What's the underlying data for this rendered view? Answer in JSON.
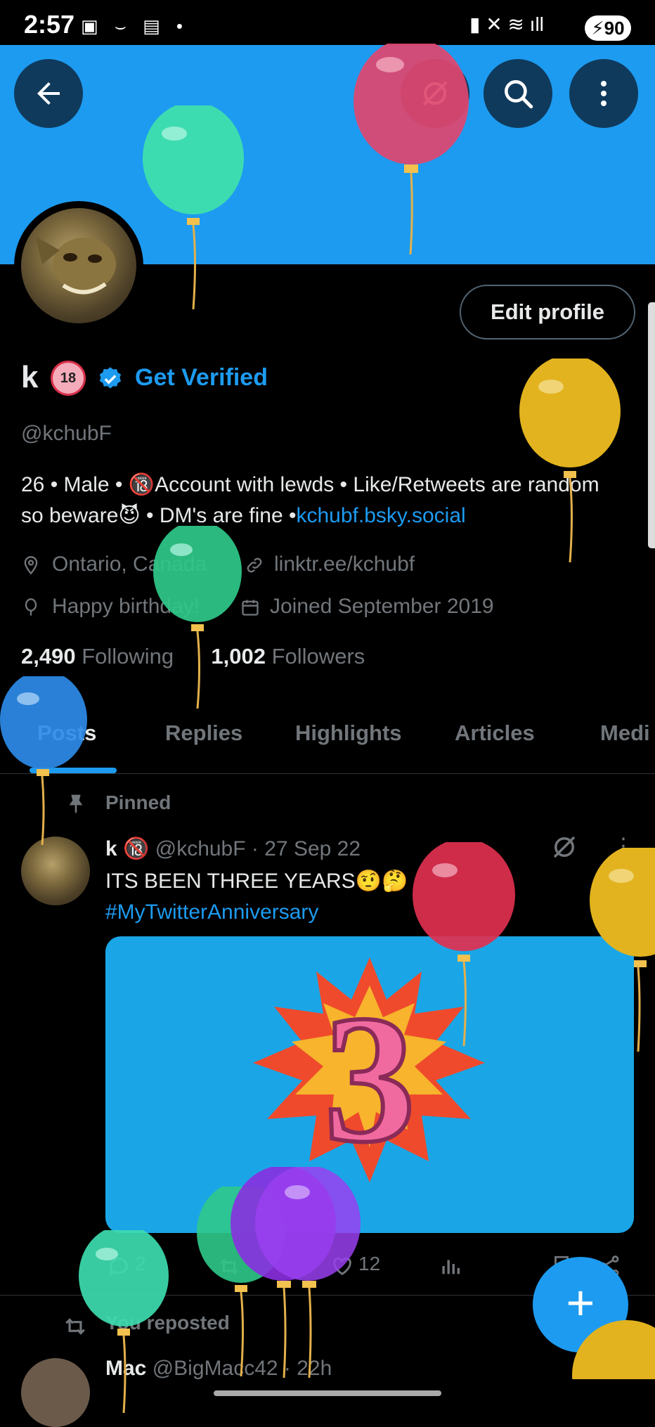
{
  "status_bar": {
    "time": "2:57",
    "battery": "90"
  },
  "header": {
    "back_icon": "arrow-left-icon",
    "grok_icon": "grok-icon",
    "search_icon": "search-icon",
    "more_icon": "more-vertical-icon"
  },
  "profile": {
    "name": "k",
    "name_badge": "🔞",
    "get_verified": "Get Verified",
    "handle": "@kchubF",
    "edit_profile": "Edit profile",
    "bio_text": "26 • Male • 🔞Account with lewds  • Like/Retweets are random so beware😈 • DM's are fine •",
    "bio_link": "kchubf.bsky.social",
    "location": "Ontario, Canada",
    "website": "linktr.ee/kchubf",
    "birthday": "Happy birthday!",
    "joined": "Joined September 2019",
    "following_count": "2,490",
    "following_label": "Following",
    "followers_count": "1,002",
    "followers_label": "Followers"
  },
  "tabs": [
    "Posts",
    "Replies",
    "Highlights",
    "Articles",
    "Medi"
  ],
  "pinned_tweet": {
    "pinned_label": "Pinned",
    "name": "k",
    "badge": "🔞",
    "handle": "@kchubF",
    "date": "· 27 Sep 22",
    "text": "ITS BEEN THREE YEARS🤨🤔",
    "hashtag": "#MyTwitterAnniversary",
    "media_number": "3",
    "replies": "2",
    "likes": "12"
  },
  "next_tweet": {
    "reposted_label": "You reposted",
    "name": "Mac",
    "handle": "@BigMacc42",
    "time": "· 22h"
  },
  "colors": {
    "accent": "#1d9bf0",
    "banner": "#1d9bf0",
    "background": "#000000"
  }
}
